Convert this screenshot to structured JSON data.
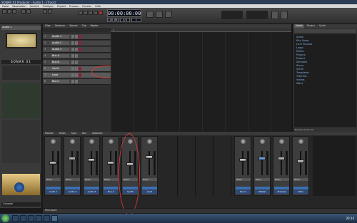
{
  "window": {
    "title": "SONAR X1 Producer - Audio 1 - [Track]"
  },
  "menu": [
    "Datei",
    "Bearbeiten",
    "Ansicht",
    "Einfügen",
    "Projekt",
    "Prozess",
    "Fenster",
    "Hilfe"
  ],
  "transport": {
    "time": "00:00:00:00",
    "tempo": "120.00",
    "meter": "4/4",
    "key": "C"
  },
  "inspector": {
    "logo": "SONAR X1",
    "track_label": "Audio 1",
    "footer": "Console"
  },
  "trackview": {
    "toolbar": [
      "Clips",
      "Optionen",
      "Spuren",
      "Clip",
      "Region"
    ],
    "timeline_label": "1",
    "tracks": [
      {
        "num": "1",
        "name": "Audio 1"
      },
      {
        "num": "2",
        "name": "Audio 2"
      },
      {
        "num": "3",
        "name": "Audio 3"
      },
      {
        "num": "4",
        "name": "Bus A"
      },
      {
        "num": "5",
        "name": "Bus B"
      },
      {
        "num": "6",
        "name": "Synth"
      },
      {
        "num": "7",
        "name": "Lead"
      },
      {
        "num": "8",
        "name": "Bus C"
      }
    ]
  },
  "browser": {
    "tabs": [
      "Media",
      "Plugins",
      "Synth"
    ],
    "tree": [
      "Audio",
      "Kits Sonar",
      "Lo-Fi Sounds",
      "Loops",
      "Media",
      "Plugins",
      "Project",
      "Samples",
      "Sonar",
      "Synth",
      "Templates",
      "Tutorials",
      "Videos",
      "Wavs"
    ],
    "status": "Browser Sonar X1"
  },
  "console": {
    "toolbar": [
      "Module",
      "Strips",
      "Spur",
      "Bus",
      "Optionen"
    ],
    "strips": [
      {
        "name": "Audio 1",
        "mode": "Read"
      },
      {
        "name": "Audio 2",
        "mode": "Read"
      },
      {
        "name": "Audio 3",
        "mode": "Read"
      },
      {
        "name": "Bus A",
        "mode": "Read"
      },
      {
        "name": "Synth",
        "mode": "Read"
      },
      {
        "name": "Lead",
        "mode": "Read"
      },
      {
        "name": "Bus C",
        "mode": "Read"
      },
      {
        "name": "Master",
        "mode": "Read"
      },
      {
        "name": "Preview",
        "mode": "Read"
      },
      {
        "name": "Main",
        "mode": "Read"
      }
    ],
    "footer": "Mischpult"
  },
  "taskbar": {
    "time": "20:14"
  },
  "colors": {
    "accent": "#3a6fb5",
    "highlight": "#d43a3a",
    "lcd": "#0a0f1a"
  }
}
